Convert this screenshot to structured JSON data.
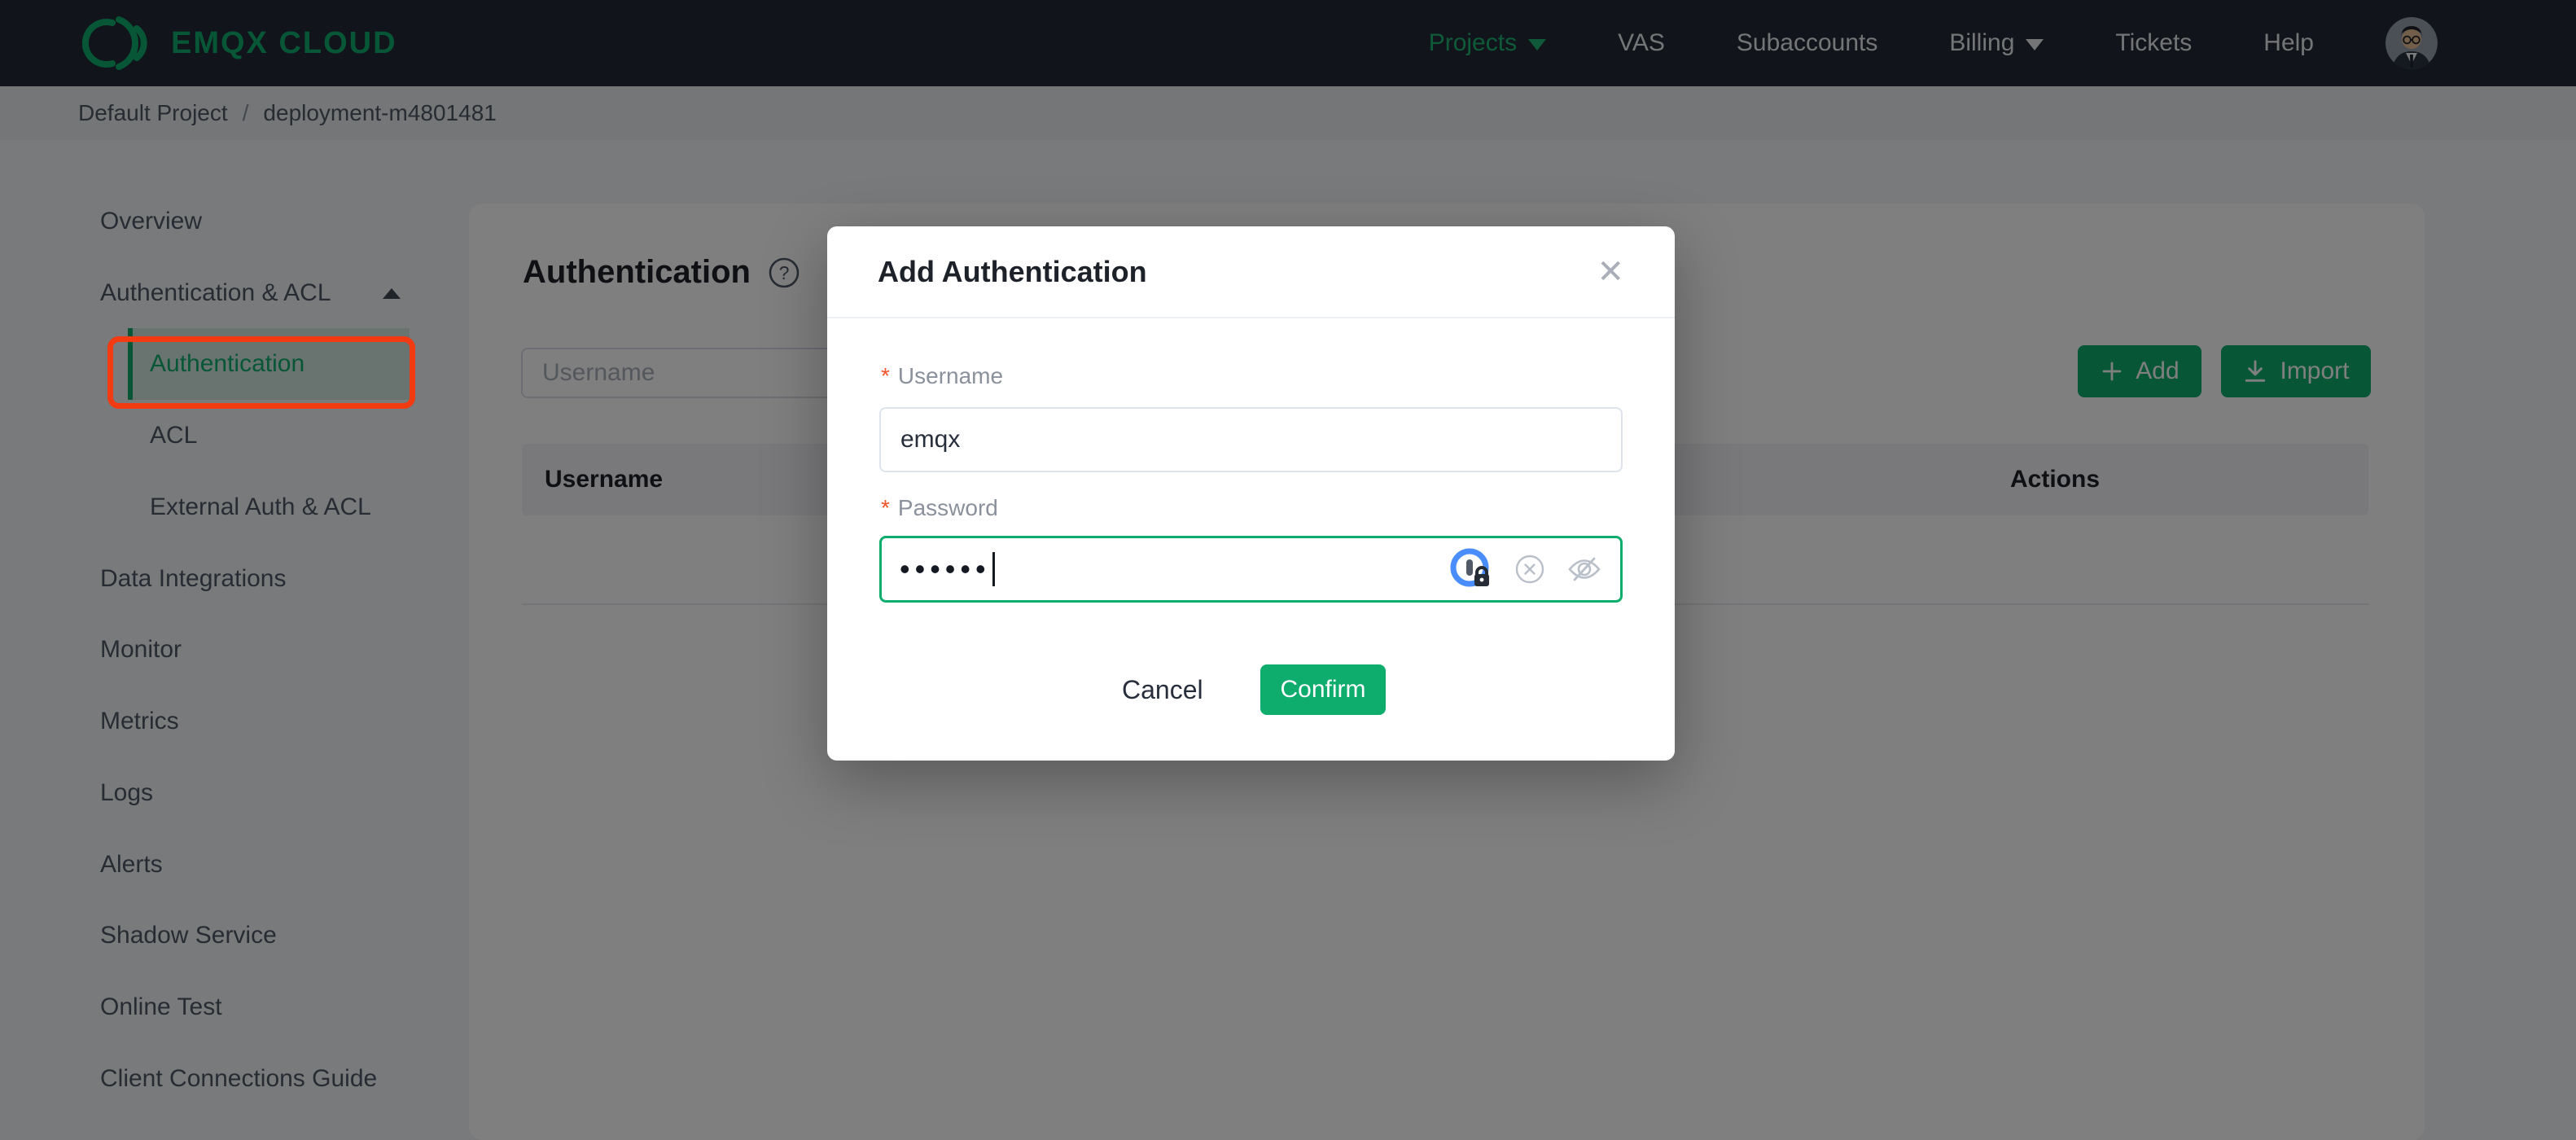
{
  "navbar": {
    "logo_text": "EMQX CLOUD",
    "items": [
      {
        "label": "Projects",
        "caret": true,
        "active": true
      },
      {
        "label": "VAS",
        "caret": false,
        "active": false
      },
      {
        "label": "Subaccounts",
        "caret": false,
        "active": false
      },
      {
        "label": "Billing",
        "caret": true,
        "active": false
      },
      {
        "label": "Tickets",
        "caret": false,
        "active": false
      },
      {
        "label": "Help",
        "caret": false,
        "active": false
      }
    ]
  },
  "breadcrumb": {
    "project": "Default Project",
    "separator": "/",
    "deployment": "deployment-m4801481"
  },
  "sidebar": {
    "items": [
      {
        "label": "Overview"
      },
      {
        "label": "Authentication & ACL",
        "expanded": true
      },
      {
        "label": "Authentication",
        "active": true
      },
      {
        "label": "ACL"
      },
      {
        "label": "External Auth & ACL"
      },
      {
        "label": "Data Integrations"
      },
      {
        "label": "Monitor"
      },
      {
        "label": "Metrics"
      },
      {
        "label": "Logs"
      },
      {
        "label": "Alerts"
      },
      {
        "label": "Shadow Service"
      },
      {
        "label": "Online Test"
      },
      {
        "label": "Client Connections Guide"
      }
    ]
  },
  "main": {
    "title": "Authentication",
    "help_icon": "question-circle-icon",
    "search_placeholder": "Username",
    "add_label": "Add",
    "import_label": "Import",
    "table": {
      "columns": [
        "Username",
        "Actions"
      ],
      "rows": []
    }
  },
  "modal": {
    "title": "Add Authentication",
    "close_label": "✕",
    "username_label": "Username",
    "username_value": "emqx",
    "password_label": "Password",
    "password_masked": "••••••",
    "required_marker": "*",
    "cancel_label": "Cancel",
    "confirm_label": "Confirm"
  },
  "annotation": {
    "color": "#f23a13",
    "target": "sidebar-item-authentication"
  },
  "colors": {
    "brand_green": "#0eac6d",
    "navbar_bg": "#232936",
    "mask": "rgba(0,0,0,0.5)",
    "annotation_red": "#f23a13",
    "required_red": "#f3542c"
  }
}
